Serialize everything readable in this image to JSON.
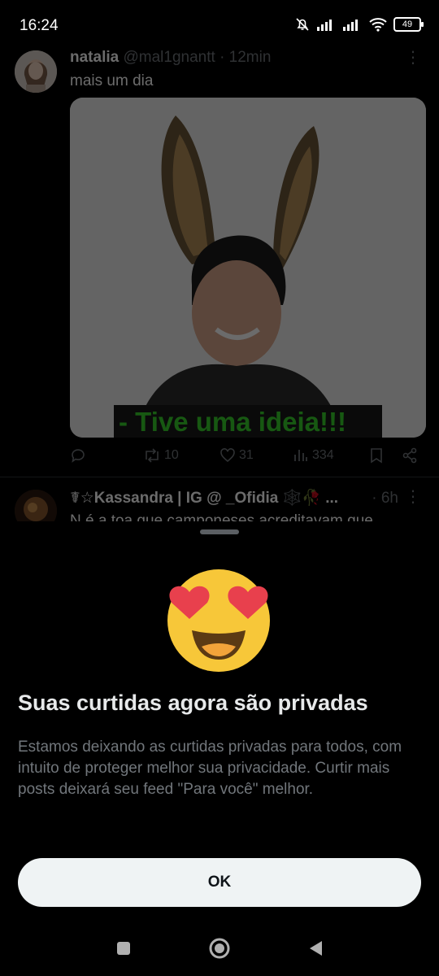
{
  "status_bar": {
    "time": "16:24",
    "battery": "49"
  },
  "tweets": [
    {
      "name": "natalia",
      "handle": "@mal1gnantt",
      "time": "· 12min",
      "text": "mais um dia",
      "media_caption": "- Tive uma ideia!!!",
      "retweets": "10",
      "likes": "31",
      "views": "334"
    },
    {
      "name": "☤☆Kassandra | IG @ _Ofidia 🕸️🥀 ...",
      "time": "· 6h",
      "text": "N é a toa que camponeses acreditavam que"
    }
  ],
  "sheet": {
    "title": "Suas curtidas agora são privadas",
    "body": "Estamos deixando as curtidas privadas para todos, com intuito de proteger melhor sua privacidade. Curtir mais posts deixará seu feed \"Para você\" melhor.",
    "button": "OK"
  },
  "icons": {
    "reply": "reply-icon",
    "retweet": "retweet-icon",
    "like": "like-icon",
    "views": "views-icon",
    "bookmark": "bookmark-icon",
    "share": "share-icon",
    "emoji": "smiling-face-with-heart-eyes-icon"
  }
}
